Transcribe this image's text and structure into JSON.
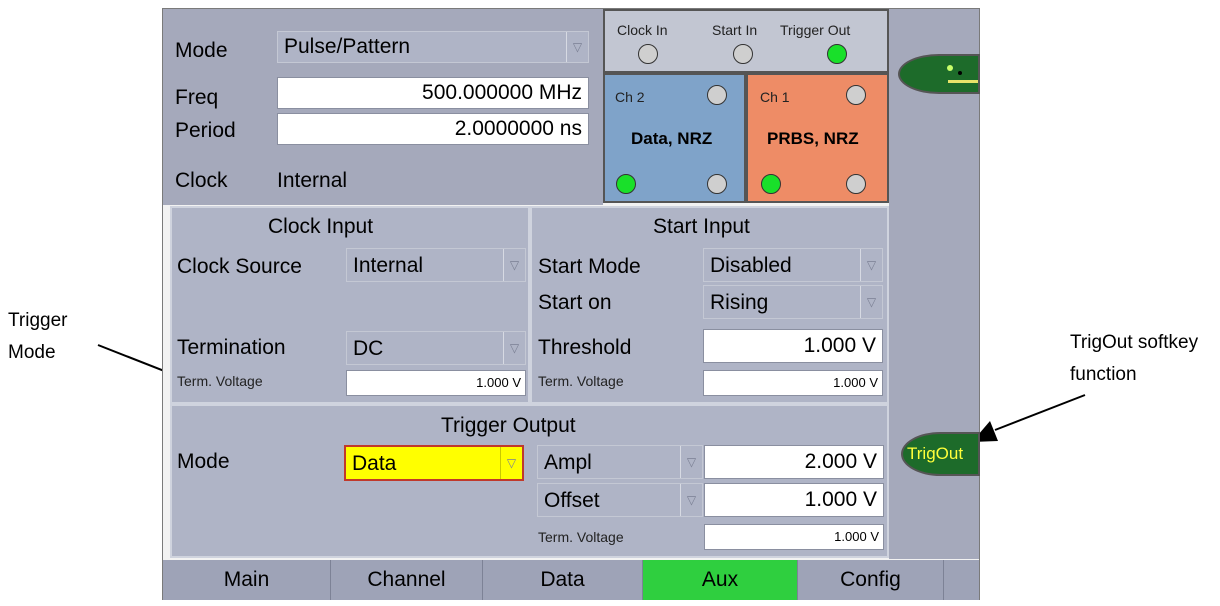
{
  "annotations": {
    "trigger_mode": "Trigger\nMode",
    "trigout": "TrigOut softkey\nfunction"
  },
  "top": {
    "mode_label": "Mode",
    "mode_value": "Pulse/Pattern",
    "freq_label": "Freq",
    "freq_value": "500.000000 MHz",
    "period_label": "Period",
    "period_value": "2.0000000 ns",
    "clock_label": "Clock",
    "clock_value": "Internal"
  },
  "io": {
    "clock_in": "Clock In",
    "start_in": "Start In",
    "trigger_out": "Trigger Out",
    "ch2_label": "Ch 2",
    "ch2_desc": "Data, NRZ",
    "ch1_label": "Ch 1",
    "ch1_desc": "PRBS, NRZ"
  },
  "clock_input": {
    "title": "Clock Input",
    "source_label": "Clock Source",
    "source_value": "Internal",
    "term_label": "Termination",
    "term_value": "DC",
    "term_voltage_label": "Term. Voltage",
    "term_voltage_value": "1.000 V"
  },
  "start_input": {
    "title": "Start Input",
    "mode_label": "Start Mode",
    "mode_value": "Disabled",
    "on_label": "Start on",
    "on_value": "Rising",
    "threshold_label": "Threshold",
    "threshold_value": "1.000 V",
    "term_voltage_label": "Term. Voltage",
    "term_voltage_value": "1.000 V"
  },
  "trigger_output": {
    "title": "Trigger Output",
    "mode_label": "Mode",
    "mode_value": "Data",
    "ampl_label": "Ampl",
    "ampl_value": "2.000 V",
    "offset_label": "Offset",
    "offset_value": "1.000 V",
    "term_voltage_label": "Term. Voltage",
    "term_voltage_value": "1.000 V"
  },
  "softkey": {
    "trigout": "TrigOut"
  },
  "tabs": [
    {
      "label": "Main"
    },
    {
      "label": "Channel"
    },
    {
      "label": "Data"
    },
    {
      "label": "Aux"
    },
    {
      "label": "Config"
    }
  ],
  "colors": {
    "ch2": "#7fa3c9",
    "ch1": "#ee8c66",
    "active_tab": "#2fcf3f",
    "highlight": "#ffff00"
  }
}
